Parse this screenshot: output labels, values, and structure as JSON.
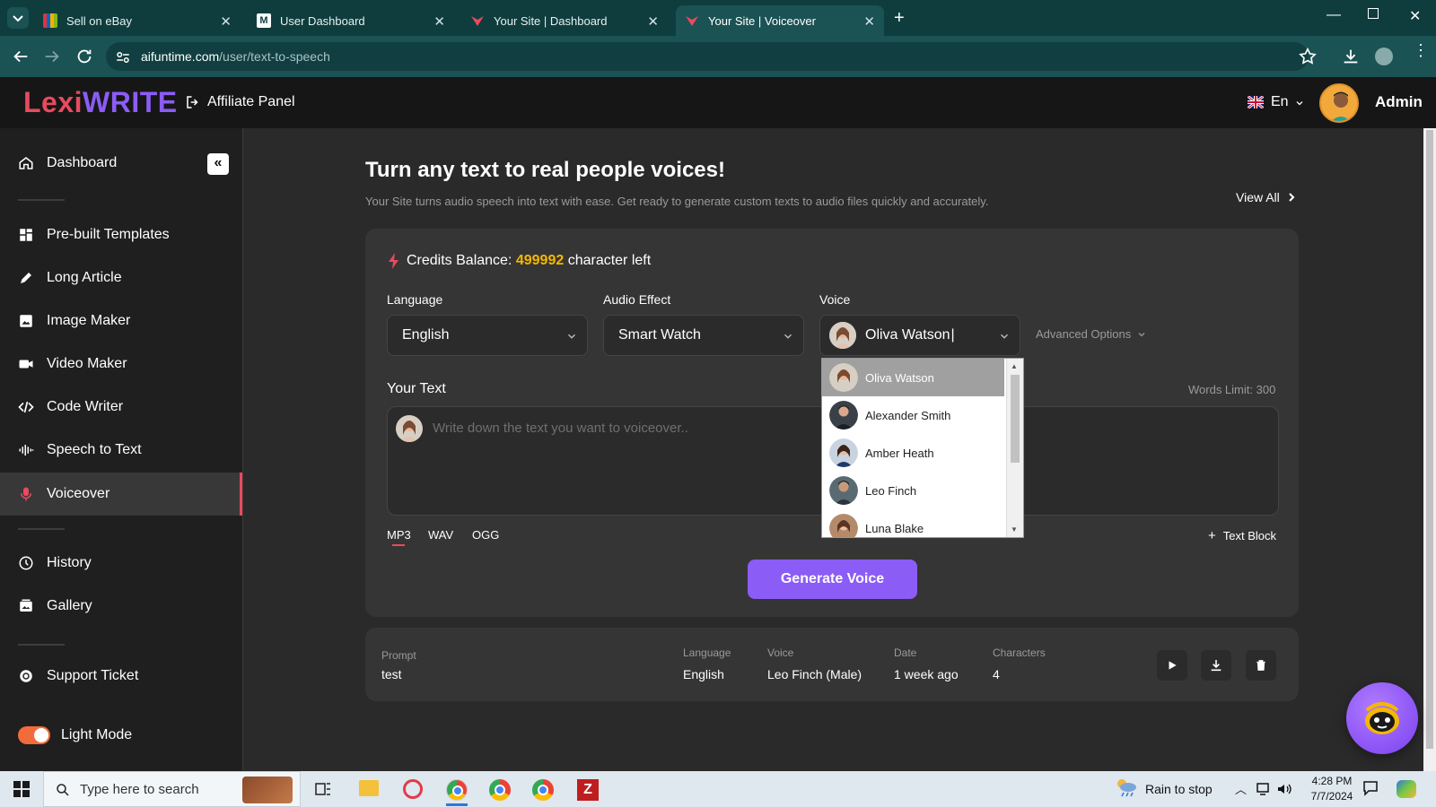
{
  "browser": {
    "tabs": [
      {
        "title": "Sell on eBay",
        "active": false
      },
      {
        "title": "User Dashboard",
        "active": false
      },
      {
        "title": "Your Site | Dashboard",
        "active": false
      },
      {
        "title": "Your Site | Voiceover",
        "active": true
      }
    ],
    "url_domain": "aifuntime.com",
    "url_path": "/user/text-to-speech"
  },
  "header": {
    "logo_part1": "Lexi",
    "logo_part2": "WRITE",
    "affiliate_label": "Affiliate Panel",
    "language_label": "En",
    "user_name": "Admin"
  },
  "sidebar": {
    "items": [
      {
        "label": "Dashboard",
        "icon": "home-icon"
      },
      {
        "label": "Pre-built Templates",
        "icon": "grid-icon"
      },
      {
        "label": "Long Article",
        "icon": "pen-icon"
      },
      {
        "label": "Image Maker",
        "icon": "image-icon"
      },
      {
        "label": "Video Maker",
        "icon": "video-icon"
      },
      {
        "label": "Code Writer",
        "icon": "code-icon"
      },
      {
        "label": "Speech to Text",
        "icon": "waveform-icon"
      },
      {
        "label": "Voiceover",
        "icon": "mic-icon",
        "active": true
      },
      {
        "label": "History",
        "icon": "history-icon"
      },
      {
        "label": "Gallery",
        "icon": "gallery-icon"
      },
      {
        "label": "Support Ticket",
        "icon": "support-icon"
      }
    ],
    "mode_label": "Light Mode"
  },
  "main": {
    "title": "Turn any text to real people voices!",
    "subtitle": "Your Site turns audio speech into text with ease. Get ready to generate custom texts to audio files quickly and accurately.",
    "view_all": "View All",
    "credits_prefix": "Credits Balance:",
    "credits_value": "499992",
    "credits_suffix": "character left",
    "language_label": "Language",
    "language_value": "English",
    "audio_effect_label": "Audio Effect",
    "audio_effect_value": "Smart Watch",
    "voice_label": "Voice",
    "voice_value": "Oliva Watson",
    "advanced_options": "Advanced Options",
    "your_text_label": "Your Text",
    "words_limit": "Words Limit: 300",
    "text_placeholder": "Write down the text you want to voiceover..",
    "formats": [
      "MP3",
      "WAV",
      "OGG"
    ],
    "active_format": "MP3",
    "text_block": "Text Block",
    "generate_button": "Generate Voice",
    "voice_options": [
      "Oliva Watson",
      "Alexander Smith",
      "Amber Heath",
      "Leo Finch",
      "Luna Blake"
    ]
  },
  "history_row": {
    "prompt_label": "Prompt",
    "prompt_value": "test",
    "language_label": "Language",
    "language_value": "English",
    "voice_label": "Voice",
    "voice_value": "Leo Finch (Male)",
    "date_label": "Date",
    "date_value": "1 week ago",
    "characters_label": "Characters",
    "characters_value": "4"
  },
  "taskbar": {
    "search_placeholder": "Type here to search",
    "weather": "Rain to stop",
    "time": "4:28 PM",
    "date": "7/7/2024"
  },
  "colors": {
    "accent_purple": "#8b5cf6",
    "accent_red": "#e84a5f",
    "credits_yellow": "#f5b800"
  }
}
